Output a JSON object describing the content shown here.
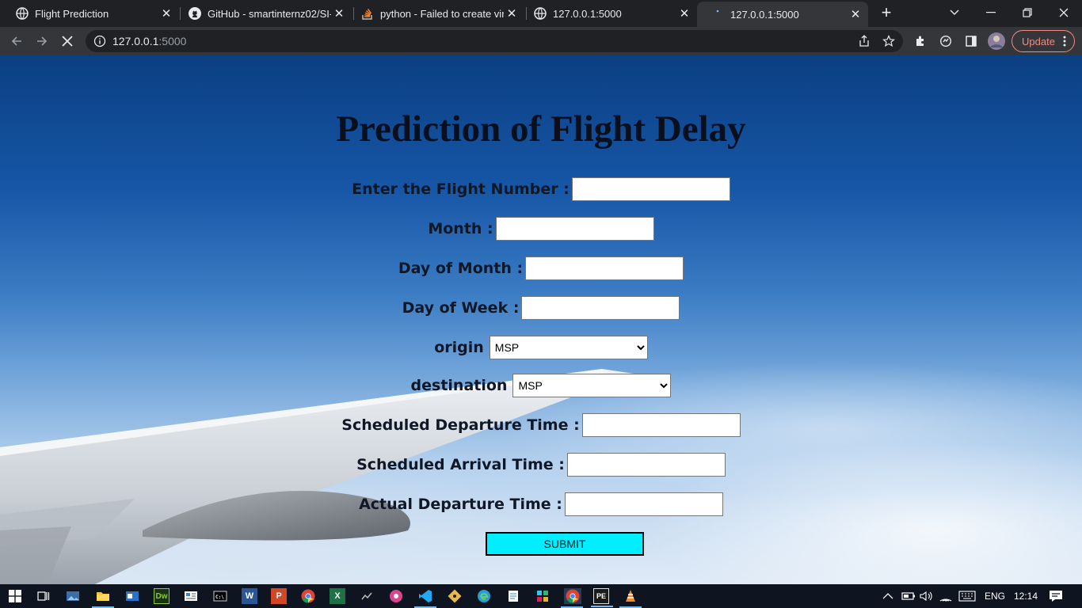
{
  "browser": {
    "tabs": [
      {
        "title": "Flight Prediction",
        "icon": "globe-icon",
        "active": false
      },
      {
        "title": "GitHub - smartinternz02/SI-G",
        "icon": "github-icon",
        "active": false
      },
      {
        "title": "python - Failed to create virtu",
        "icon": "stackoverflow-icon",
        "active": false
      },
      {
        "title": "127.0.0.1:5000",
        "icon": "globe-icon",
        "active": false
      },
      {
        "title": "127.0.0.1:5000",
        "icon": "loading-icon",
        "active": true
      }
    ],
    "address_host": "127.0.0.1",
    "address_port": ":5000",
    "update_label": "Update"
  },
  "page": {
    "title": "Prediction of Flight Delay",
    "fields": [
      {
        "label": "Enter the Flight Number :",
        "type": "text",
        "value": ""
      },
      {
        "label": "Month :",
        "type": "text",
        "value": ""
      },
      {
        "label": "Day of Month :",
        "type": "text",
        "value": ""
      },
      {
        "label": "Day of Week :",
        "type": "text",
        "value": ""
      },
      {
        "label": "origin",
        "type": "select",
        "value": "MSP"
      },
      {
        "label": "destination",
        "type": "select",
        "value": "MSP"
      },
      {
        "label": "Scheduled Departure Time :",
        "type": "text",
        "value": ""
      },
      {
        "label": "Scheduled Arrival Time :",
        "type": "text",
        "value": ""
      },
      {
        "label": "Actual Departure Time :",
        "type": "text",
        "value": ""
      }
    ],
    "submit_label": "SUBMIT"
  },
  "taskbar": {
    "language": "ENG",
    "time": "12:14",
    "apps": [
      "start-icon",
      "task-view-icon",
      "photos-icon",
      "file-explorer-icon",
      "outlook-icon",
      "dreamweaver-icon",
      "news-icon",
      "cmd-icon",
      "word-icon",
      "powerpoint-icon",
      "chrome-icon",
      "excel-icon",
      "anaconda-icon",
      "app-pink-icon",
      "vscode-icon",
      "git-icon",
      "edge-icon",
      "notepad-icon",
      "slack-icon",
      "chrome-active-icon",
      "pe-icon",
      "vlc-icon"
    ]
  },
  "colors": {
    "submit_bg": "#00eeff",
    "tab_active": "#35363a",
    "update_accent": "#f28b82"
  }
}
